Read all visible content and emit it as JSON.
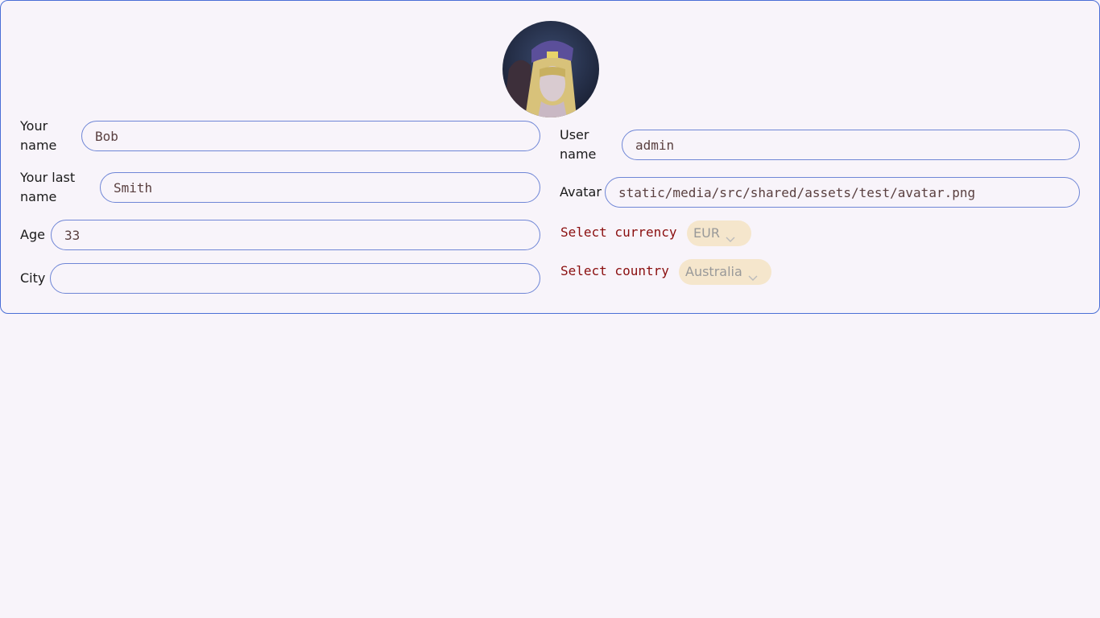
{
  "avatar": {
    "alt": "User avatar"
  },
  "form_left": {
    "first_name": {
      "label": "Your name",
      "value": "Bob"
    },
    "last_name": {
      "label": "Your last name",
      "value": "Smith"
    },
    "age": {
      "label": "Age",
      "value": "33"
    },
    "city": {
      "label": "City",
      "value": ""
    }
  },
  "form_right": {
    "username": {
      "label": "User name",
      "value": "admin"
    },
    "avatar_path": {
      "label": "Avatar",
      "value": "static/media/src/shared/assets/test/avatar.png"
    },
    "currency": {
      "label": "Select currency",
      "selected": "EUR"
    },
    "country": {
      "label": "Select country",
      "selected": "Australia"
    }
  },
  "colors": {
    "border_accent": "#4a6fd6",
    "select_label": "#8a0e0e",
    "select_bg": "#f5e6cc"
  }
}
